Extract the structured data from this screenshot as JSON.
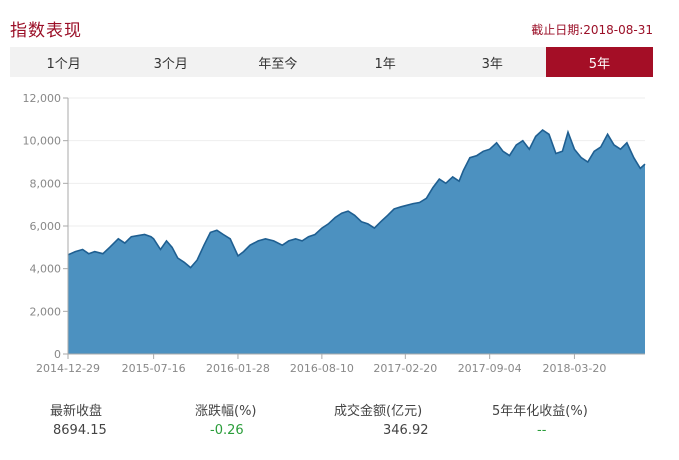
{
  "header": {
    "title": "指数表现",
    "as_of": "截止日期:2018-08-31"
  },
  "tabs": [
    {
      "label": "1个月",
      "active": false
    },
    {
      "label": "3个月",
      "active": false
    },
    {
      "label": "年至今",
      "active": false
    },
    {
      "label": "1年",
      "active": false
    },
    {
      "label": "3年",
      "active": false
    },
    {
      "label": "5年",
      "active": true
    }
  ],
  "stats": {
    "labels": [
      "最新收盘",
      "涨跌幅(%)",
      "成交金额(亿元)",
      "5年年化收益(%)"
    ],
    "values": [
      "8694.15",
      "-0.26",
      "346.92",
      "--"
    ]
  },
  "colors": {
    "accent": "#a40e26",
    "area_fill": "#4c91c0",
    "line": "#1f5f91",
    "negative": "#2a9d3a"
  },
  "chart_data": {
    "type": "area",
    "ylim": [
      0,
      12000
    ],
    "yticks": [
      "0",
      "2,000",
      "4,000",
      "6,000",
      "8,000",
      "10,000",
      "12,000"
    ],
    "xticks": [
      "2014-12-29",
      "2015-07-16",
      "2016-01-28",
      "2016-08-10",
      "2017-02-20",
      "2017-09-04",
      "2018-03-20"
    ],
    "grid": true,
    "series": [
      {
        "points": [
          [
            "2014-12-29",
            4650
          ],
          [
            "2015-01-15",
            4800
          ],
          [
            "2015-02-01",
            4900
          ],
          [
            "2015-02-15",
            4700
          ],
          [
            "2015-03-01",
            4800
          ],
          [
            "2015-03-20",
            4700
          ],
          [
            "2015-04-05",
            5000
          ],
          [
            "2015-04-25",
            5400
          ],
          [
            "2015-05-10",
            5200
          ],
          [
            "2015-05-25",
            5500
          ],
          [
            "2015-06-10",
            5550
          ],
          [
            "2015-06-25",
            5600
          ],
          [
            "2015-07-10",
            5500
          ],
          [
            "2015-07-16",
            5400
          ],
          [
            "2015-08-01",
            4900
          ],
          [
            "2015-08-15",
            5300
          ],
          [
            "2015-08-28",
            5000
          ],
          [
            "2015-09-10",
            4500
          ],
          [
            "2015-09-25",
            4300
          ],
          [
            "2015-10-10",
            4050
          ],
          [
            "2015-10-25",
            4400
          ],
          [
            "2015-11-10",
            5100
          ],
          [
            "2015-11-25",
            5700
          ],
          [
            "2015-12-10",
            5800
          ],
          [
            "2015-12-25",
            5600
          ],
          [
            "2016-01-10",
            5400
          ],
          [
            "2016-01-28",
            4600
          ],
          [
            "2016-02-10",
            4800
          ],
          [
            "2016-02-25",
            5100
          ],
          [
            "2016-03-15",
            5300
          ],
          [
            "2016-04-01",
            5400
          ],
          [
            "2016-04-20",
            5300
          ],
          [
            "2016-05-10",
            5100
          ],
          [
            "2016-05-25",
            5300
          ],
          [
            "2016-06-10",
            5400
          ],
          [
            "2016-06-25",
            5300
          ],
          [
            "2016-07-10",
            5500
          ],
          [
            "2016-07-25",
            5600
          ],
          [
            "2016-08-10",
            5900
          ],
          [
            "2016-08-25",
            6100
          ],
          [
            "2016-09-10",
            6400
          ],
          [
            "2016-09-25",
            6600
          ],
          [
            "2016-10-10",
            6700
          ],
          [
            "2016-10-25",
            6500
          ],
          [
            "2016-11-10",
            6200
          ],
          [
            "2016-11-25",
            6100
          ],
          [
            "2016-12-10",
            5900
          ],
          [
            "2016-12-25",
            6200
          ],
          [
            "2017-01-10",
            6500
          ],
          [
            "2017-01-25",
            6800
          ],
          [
            "2017-02-10",
            6900
          ],
          [
            "2017-02-20",
            6950
          ],
          [
            "2017-03-10",
            7050
          ],
          [
            "2017-03-25",
            7100
          ],
          [
            "2017-04-10",
            7300
          ],
          [
            "2017-04-25",
            7800
          ],
          [
            "2017-05-10",
            8200
          ],
          [
            "2017-05-25",
            8000
          ],
          [
            "2017-06-10",
            8300
          ],
          [
            "2017-06-25",
            8100
          ],
          [
            "2017-07-05",
            8600
          ],
          [
            "2017-07-20",
            9200
          ],
          [
            "2017-08-05",
            9300
          ],
          [
            "2017-08-20",
            9500
          ],
          [
            "2017-09-04",
            9600
          ],
          [
            "2017-09-20",
            9900
          ],
          [
            "2017-10-05",
            9500
          ],
          [
            "2017-10-20",
            9300
          ],
          [
            "2017-11-05",
            9800
          ],
          [
            "2017-11-20",
            10000
          ],
          [
            "2017-12-05",
            9600
          ],
          [
            "2017-12-20",
            10200
          ],
          [
            "2018-01-05",
            10500
          ],
          [
            "2018-01-20",
            10300
          ],
          [
            "2018-02-05",
            9400
          ],
          [
            "2018-02-20",
            9500
          ],
          [
            "2018-03-05",
            10400
          ],
          [
            "2018-03-20",
            9600
          ],
          [
            "2018-04-05",
            9200
          ],
          [
            "2018-04-20",
            9000
          ],
          [
            "2018-05-05",
            9500
          ],
          [
            "2018-05-20",
            9700
          ],
          [
            "2018-06-05",
            10300
          ],
          [
            "2018-06-20",
            9800
          ],
          [
            "2018-07-05",
            9600
          ],
          [
            "2018-07-20",
            9900
          ],
          [
            "2018-08-05",
            9200
          ],
          [
            "2018-08-20",
            8700
          ],
          [
            "2018-08-31",
            8900
          ]
        ]
      }
    ]
  }
}
